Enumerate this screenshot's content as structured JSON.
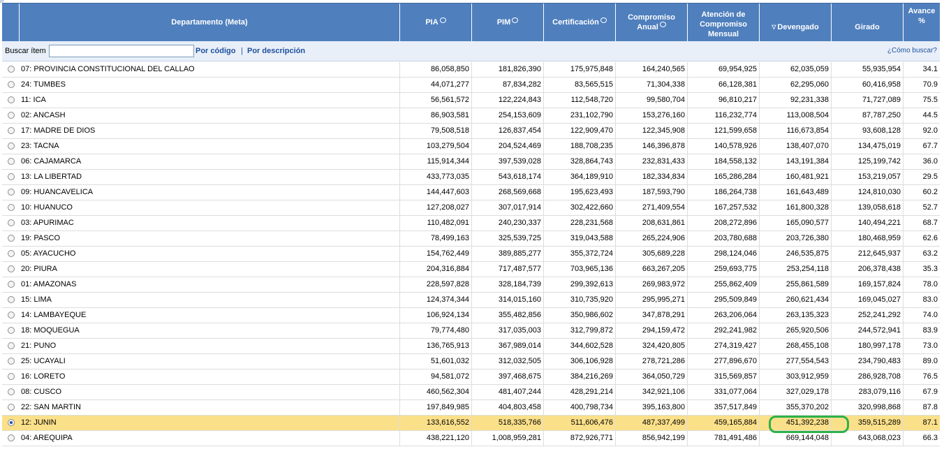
{
  "header": {
    "departamento": "Departamento (Meta)",
    "pia": "PIA",
    "pim": "PIM",
    "certificacion": "Certificación",
    "compromiso_line1": "Compromiso",
    "compromiso_line2": "Anual",
    "atencion_line1": "Atención de",
    "atencion_line2": "Compromiso",
    "atencion_line3": "Mensual",
    "devengado": "Devengado",
    "girado": "Girado",
    "avance_line1": "Avance",
    "avance_line2": "%"
  },
  "search": {
    "label": "Buscar ítem",
    "value": "",
    "placeholder": "",
    "by_code": "Por código",
    "separator": "|",
    "by_description": "Por descripción",
    "help": "¿Cómo buscar?"
  },
  "colors": {
    "header_bg": "#4f7fbd",
    "selected_row": "#fbe08a",
    "highlight_border": "#2db14a"
  },
  "rows": [
    {
      "name": "07: PROVINCIA CONSTITUCIONAL DEL CALLAO",
      "pia": "86,058,850",
      "pim": "181,826,390",
      "cert": "175,975,848",
      "comp": "164,240,565",
      "aten": "69,954,925",
      "dev": "62,035,059",
      "gir": "55,935,954",
      "av": "34.1",
      "selected": false
    },
    {
      "name": "24: TUMBES",
      "pia": "44,071,277",
      "pim": "87,834,282",
      "cert": "83,565,515",
      "comp": "71,304,338",
      "aten": "66,128,381",
      "dev": "62,295,060",
      "gir": "60,416,958",
      "av": "70.9",
      "selected": false
    },
    {
      "name": "11: ICA",
      "pia": "56,561,572",
      "pim": "122,224,843",
      "cert": "112,548,720",
      "comp": "99,580,704",
      "aten": "96,810,217",
      "dev": "92,231,338",
      "gir": "71,727,089",
      "av": "75.5",
      "selected": false
    },
    {
      "name": "02: ANCASH",
      "pia": "86,903,581",
      "pim": "254,153,609",
      "cert": "231,102,790",
      "comp": "153,276,160",
      "aten": "116,232,774",
      "dev": "113,008,504",
      "gir": "87,787,250",
      "av": "44.5",
      "selected": false
    },
    {
      "name": "17: MADRE DE DIOS",
      "pia": "79,508,518",
      "pim": "126,837,454",
      "cert": "122,909,470",
      "comp": "122,345,908",
      "aten": "121,599,658",
      "dev": "116,673,854",
      "gir": "93,608,128",
      "av": "92.0",
      "selected": false
    },
    {
      "name": "23: TACNA",
      "pia": "103,279,504",
      "pim": "204,524,469",
      "cert": "188,708,235",
      "comp": "146,396,878",
      "aten": "140,578,926",
      "dev": "138,407,070",
      "gir": "134,475,019",
      "av": "67.7",
      "selected": false
    },
    {
      "name": "06: CAJAMARCA",
      "pia": "115,914,344",
      "pim": "397,539,028",
      "cert": "328,864,743",
      "comp": "232,831,433",
      "aten": "184,558,132",
      "dev": "143,191,384",
      "gir": "125,199,742",
      "av": "36.0",
      "selected": false
    },
    {
      "name": "13: LA LIBERTAD",
      "pia": "433,773,035",
      "pim": "543,618,174",
      "cert": "364,189,910",
      "comp": "182,334,834",
      "aten": "165,286,284",
      "dev": "160,481,921",
      "gir": "153,219,057",
      "av": "29.5",
      "selected": false
    },
    {
      "name": "09: HUANCAVELICA",
      "pia": "144,447,603",
      "pim": "268,569,668",
      "cert": "195,623,493",
      "comp": "187,593,790",
      "aten": "186,264,738",
      "dev": "161,643,489",
      "gir": "124,810,030",
      "av": "60.2",
      "selected": false
    },
    {
      "name": "10: HUANUCO",
      "pia": "127,208,027",
      "pim": "307,017,914",
      "cert": "302,422,660",
      "comp": "271,409,554",
      "aten": "167,257,532",
      "dev": "161,800,328",
      "gir": "139,058,618",
      "av": "52.7",
      "selected": false
    },
    {
      "name": "03: APURIMAC",
      "pia": "110,482,091",
      "pim": "240,230,337",
      "cert": "228,231,568",
      "comp": "208,631,861",
      "aten": "208,272,896",
      "dev": "165,090,577",
      "gir": "140,494,221",
      "av": "68.7",
      "selected": false
    },
    {
      "name": "19: PASCO",
      "pia": "78,499,163",
      "pim": "325,539,725",
      "cert": "319,043,588",
      "comp": "265,224,906",
      "aten": "203,780,688",
      "dev": "203,726,380",
      "gir": "180,468,959",
      "av": "62.6",
      "selected": false
    },
    {
      "name": "05: AYACUCHO",
      "pia": "154,762,449",
      "pim": "389,885,277",
      "cert": "355,372,724",
      "comp": "305,689,228",
      "aten": "298,124,046",
      "dev": "246,535,875",
      "gir": "212,645,937",
      "av": "63.2",
      "selected": false
    },
    {
      "name": "20: PIURA",
      "pia": "204,316,884",
      "pim": "717,487,577",
      "cert": "703,965,136",
      "comp": "663,267,205",
      "aten": "259,693,775",
      "dev": "253,254,118",
      "gir": "206,378,438",
      "av": "35.3",
      "selected": false
    },
    {
      "name": "01: AMAZONAS",
      "pia": "228,597,828",
      "pim": "328,184,739",
      "cert": "299,392,613",
      "comp": "269,983,972",
      "aten": "255,862,409",
      "dev": "255,861,589",
      "gir": "169,157,824",
      "av": "78.0",
      "selected": false
    },
    {
      "name": "15: LIMA",
      "pia": "124,374,344",
      "pim": "314,015,160",
      "cert": "310,735,920",
      "comp": "295,995,271",
      "aten": "295,509,849",
      "dev": "260,621,434",
      "gir": "169,045,027",
      "av": "83.0",
      "selected": false
    },
    {
      "name": "14: LAMBAYEQUE",
      "pia": "106,924,134",
      "pim": "355,482,856",
      "cert": "350,986,602",
      "comp": "347,878,291",
      "aten": "263,206,064",
      "dev": "263,135,323",
      "gir": "252,241,292",
      "av": "74.0",
      "selected": false
    },
    {
      "name": "18: MOQUEGUA",
      "pia": "79,774,480",
      "pim": "317,035,003",
      "cert": "312,799,872",
      "comp": "294,159,472",
      "aten": "292,241,982",
      "dev": "265,920,506",
      "gir": "244,572,941",
      "av": "83.9",
      "selected": false
    },
    {
      "name": "21: PUNO",
      "pia": "136,765,913",
      "pim": "367,989,014",
      "cert": "344,602,528",
      "comp": "324,420,805",
      "aten": "274,319,427",
      "dev": "268,455,108",
      "gir": "180,997,178",
      "av": "73.0",
      "selected": false
    },
    {
      "name": "25: UCAYALI",
      "pia": "51,601,032",
      "pim": "312,032,505",
      "cert": "306,106,928",
      "comp": "278,721,286",
      "aten": "277,896,670",
      "dev": "277,554,543",
      "gir": "234,790,483",
      "av": "89.0",
      "selected": false
    },
    {
      "name": "16: LORETO",
      "pia": "94,581,072",
      "pim": "397,468,675",
      "cert": "384,216,269",
      "comp": "364,050,729",
      "aten": "315,569,857",
      "dev": "303,912,959",
      "gir": "286,928,708",
      "av": "76.5",
      "selected": false
    },
    {
      "name": "08: CUSCO",
      "pia": "460,562,304",
      "pim": "481,407,244",
      "cert": "428,291,214",
      "comp": "342,921,106",
      "aten": "331,077,064",
      "dev": "327,029,178",
      "gir": "283,079,116",
      "av": "67.9",
      "selected": false
    },
    {
      "name": "22: SAN MARTIN",
      "pia": "197,849,985",
      "pim": "404,803,458",
      "cert": "400,798,734",
      "comp": "395,163,800",
      "aten": "357,517,849",
      "dev": "355,370,202",
      "gir": "320,998,868",
      "av": "87.8",
      "selected": false
    },
    {
      "name": "12: JUNIN",
      "pia": "133,616,552",
      "pim": "518,335,766",
      "cert": "511,606,476",
      "comp": "487,337,499",
      "aten": "459,165,884",
      "dev": "451,392,238",
      "gir": "359,515,289",
      "av": "87.1",
      "selected": true
    },
    {
      "name": "04: AREQUIPA",
      "pia": "438,221,120",
      "pim": "1,008,959,281",
      "cert": "872,926,771",
      "comp": "856,942,199",
      "aten": "781,491,486",
      "dev": "669,144,048",
      "gir": "643,068,023",
      "av": "66.3",
      "selected": false
    }
  ]
}
